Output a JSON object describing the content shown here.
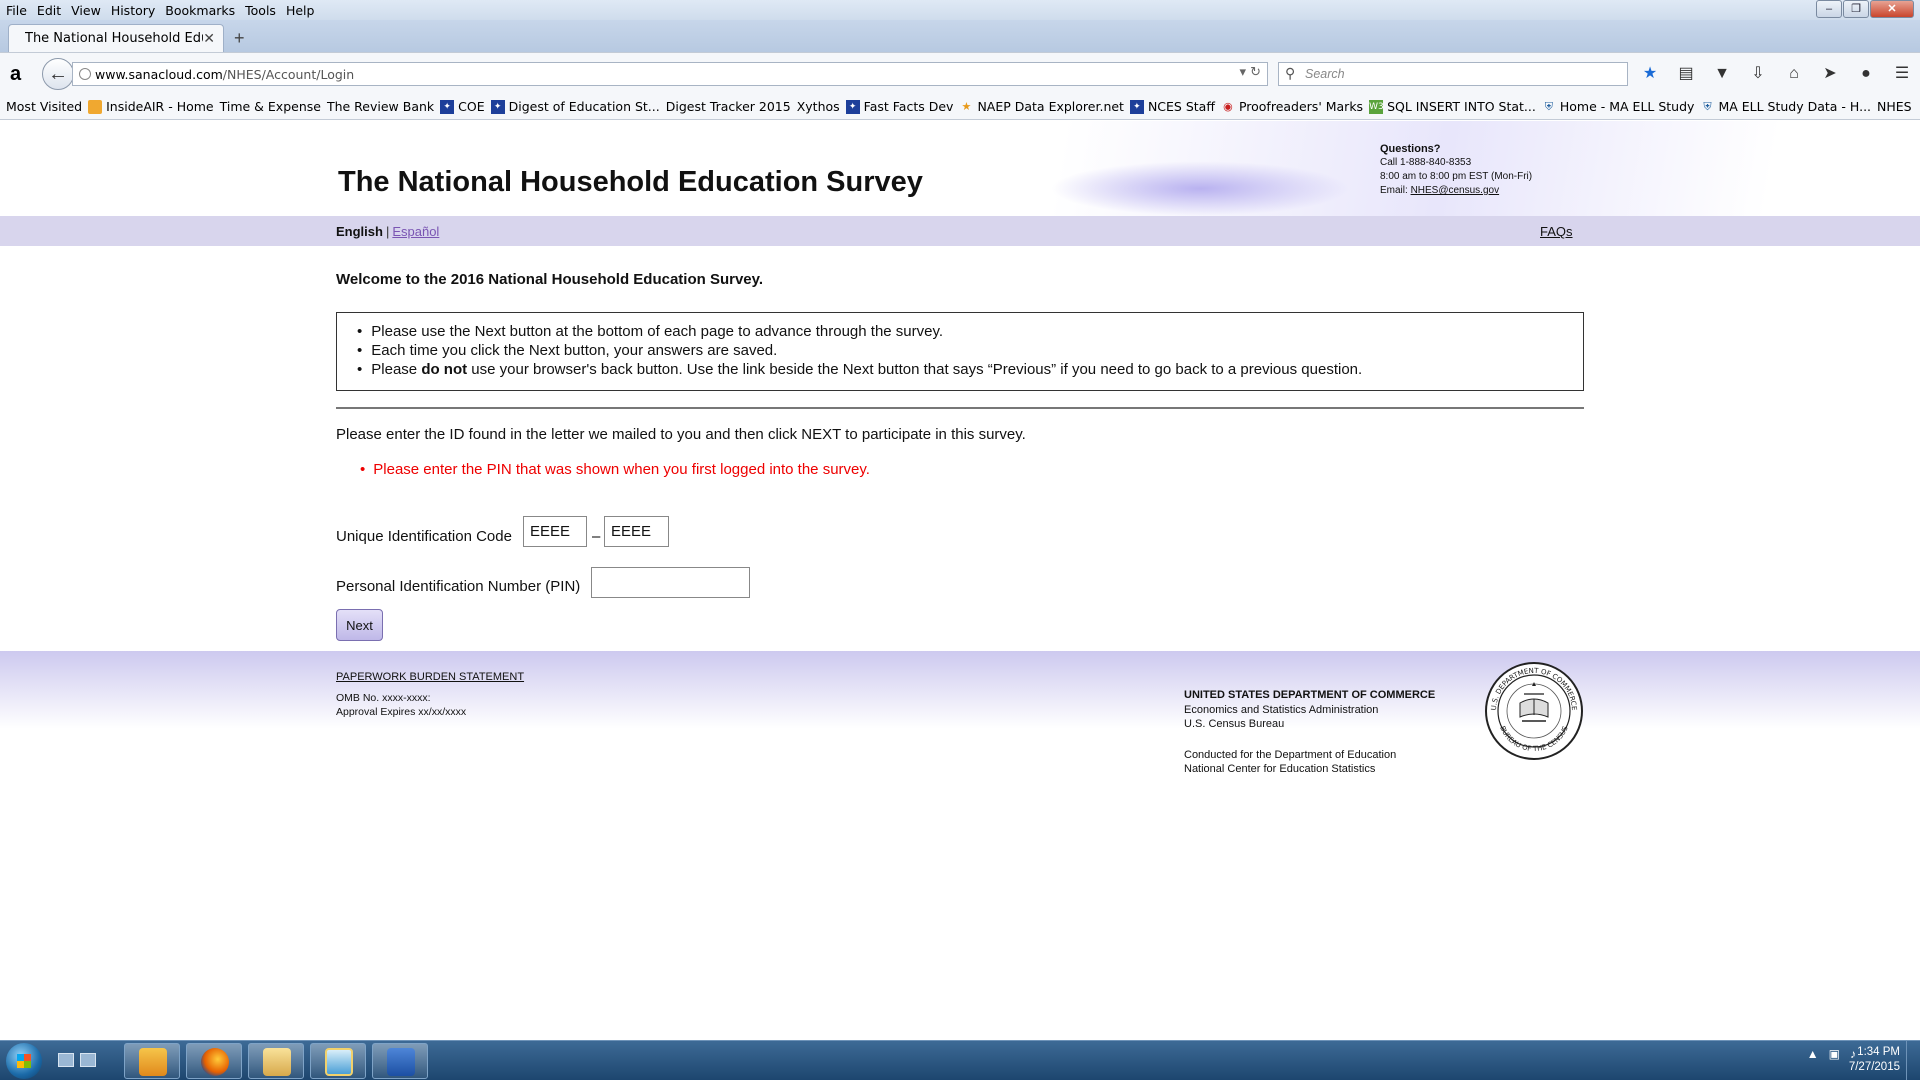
{
  "browser": {
    "menu": [
      "File",
      "Edit",
      "View",
      "History",
      "Bookmarks",
      "Tools",
      "Help"
    ],
    "tab_title": "The National Household Educa...",
    "url_domain": "www.sanacloud.com",
    "url_path": "/NHES/Account/Login",
    "url_prefix": "",
    "search_placeholder": "Search",
    "bookmarks": [
      {
        "label": "Most Visited",
        "icon": "page"
      },
      {
        "label": "InsideAIR - Home",
        "icon": "orange"
      },
      {
        "label": "Time & Expense",
        "icon": "page"
      },
      {
        "label": "The Review Bank",
        "icon": "page"
      },
      {
        "label": "COE",
        "icon": "blue"
      },
      {
        "label": "Digest of Education St...",
        "icon": "blue"
      },
      {
        "label": "Digest Tracker 2015",
        "icon": "page"
      },
      {
        "label": "Xythos",
        "icon": "page"
      },
      {
        "label": "Fast Facts Dev",
        "icon": "blue"
      },
      {
        "label": "NAEP Data Explorer.net",
        "icon": "star"
      },
      {
        "label": "NCES Staff",
        "icon": "blue"
      },
      {
        "label": "Proofreaders' Marks",
        "icon": "red"
      },
      {
        "label": "SQL INSERT INTO Stat...",
        "icon": "green"
      },
      {
        "label": "Home - MA ELL Study",
        "icon": "shield"
      },
      {
        "label": "MA ELL Study Data - H...",
        "icon": "shield"
      },
      {
        "label": "NHES",
        "icon": "page"
      }
    ]
  },
  "header": {
    "title": "The National Household Education Survey",
    "questions_label": "Questions?",
    "phone": "Call 1-888-840-8353",
    "hours": "8:00 am to 8:00 pm EST (Mon-Fri)",
    "email_label": "Email: ",
    "email": "NHES@census.gov"
  },
  "langbar": {
    "english": "English",
    "separator": "|",
    "spanish": "Español",
    "faqs": "FAQs"
  },
  "main": {
    "welcome": "Welcome to the 2016 National Household Education Survey.",
    "bullets": [
      "Please use the Next button at the bottom of each page to advance through the survey.",
      "Each time you click the Next button, your answers are saved."
    ],
    "bullet3_pre": "Please ",
    "bullet3_bold": "do not",
    "bullet3_post": " use your browser's back button. Use the link beside the Next button that says “Previous” if you need to go back to a previous question.",
    "instruction": "Please enter the ID found in the letter we mailed to you and then click NEXT to participate in this survey.",
    "error": "Please enter the PIN that was shown when you first logged into the survey.",
    "uic_label": "Unique Identification Code",
    "uic_part1": "EEEE",
    "uic_dash": "–",
    "uic_part2": "EEEE",
    "pin_label": "Personal Identification Number (PIN)",
    "pin_value": "",
    "next_label": "Next"
  },
  "footer": {
    "paperwork": "PAPERWORK BURDEN STATEMENT",
    "omb": "OMB No. xxxx-xxxx:",
    "approval": "Approval Expires xx/xx/xxxx",
    "dept": "UNITED STATES DEPARTMENT OF COMMERCE",
    "esa": "Economics and Statistics Administration",
    "census": "U.S. Census Bureau",
    "conducted": "Conducted for the Department of Education",
    "nces": "National Center for Education Statistics",
    "seal_top": "U.S. DEPARTMENT OF COMMERCE",
    "seal_bottom": "BUREAU OF THE CENSUS"
  },
  "taskbar": {
    "time": "1:34 PM",
    "date": "7/27/2015",
    "apps": [
      "outlook-icon",
      "firefox-icon",
      "explorer-icon",
      "app-icon",
      "word-icon"
    ]
  },
  "colors": {
    "accent_lavender": "#d8d5ed",
    "error_red": "#ee0000",
    "link_purple": "#7a55b3"
  }
}
